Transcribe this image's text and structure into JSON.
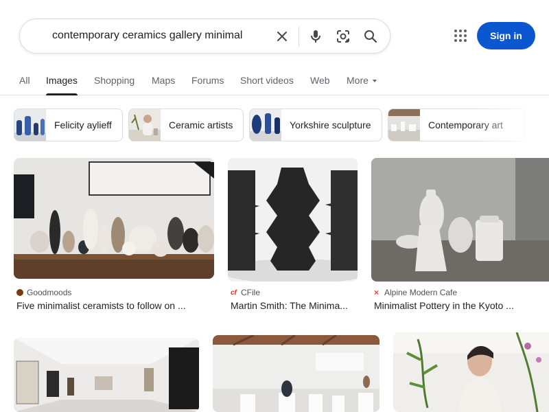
{
  "search": {
    "query": "contemporary ceramics gallery minimal"
  },
  "header": {
    "sign_in_label": "Sign in"
  },
  "tabs": [
    {
      "label": "All"
    },
    {
      "label": "Images",
      "active": true
    },
    {
      "label": "Shopping"
    },
    {
      "label": "Maps"
    },
    {
      "label": "Forums"
    },
    {
      "label": "Short videos"
    },
    {
      "label": "Web"
    },
    {
      "label": "More"
    }
  ],
  "chips": [
    {
      "label": "Felicity aylieff"
    },
    {
      "label": "Ceramic artists"
    },
    {
      "label": "Yorkshire sculpture"
    },
    {
      "label": "Contemporary art"
    }
  ],
  "results": [
    {
      "source": "Goodmoods",
      "title": "Five minimalist ceramists to follow on ..."
    },
    {
      "source": "CFile",
      "title": "Martin Smith: The Minima..."
    },
    {
      "source": "Alpine Modern Cafe",
      "title": "Minimalist Pottery in the Kyoto ..."
    },
    {
      "source": "",
      "title": ""
    },
    {
      "source": "",
      "title": ""
    },
    {
      "source": "",
      "title": ""
    }
  ],
  "colors": {
    "accent": "#0b57d0",
    "favicon_goodmoods": "#7a3b12",
    "favicon_cfile": "#d93025",
    "favicon_alpine": "#ea4335"
  },
  "icons": {
    "clear": "close-icon",
    "voice": "mic-icon",
    "image_search": "lens-camera-icon",
    "search": "search-icon",
    "apps": "apps-grid-icon"
  }
}
